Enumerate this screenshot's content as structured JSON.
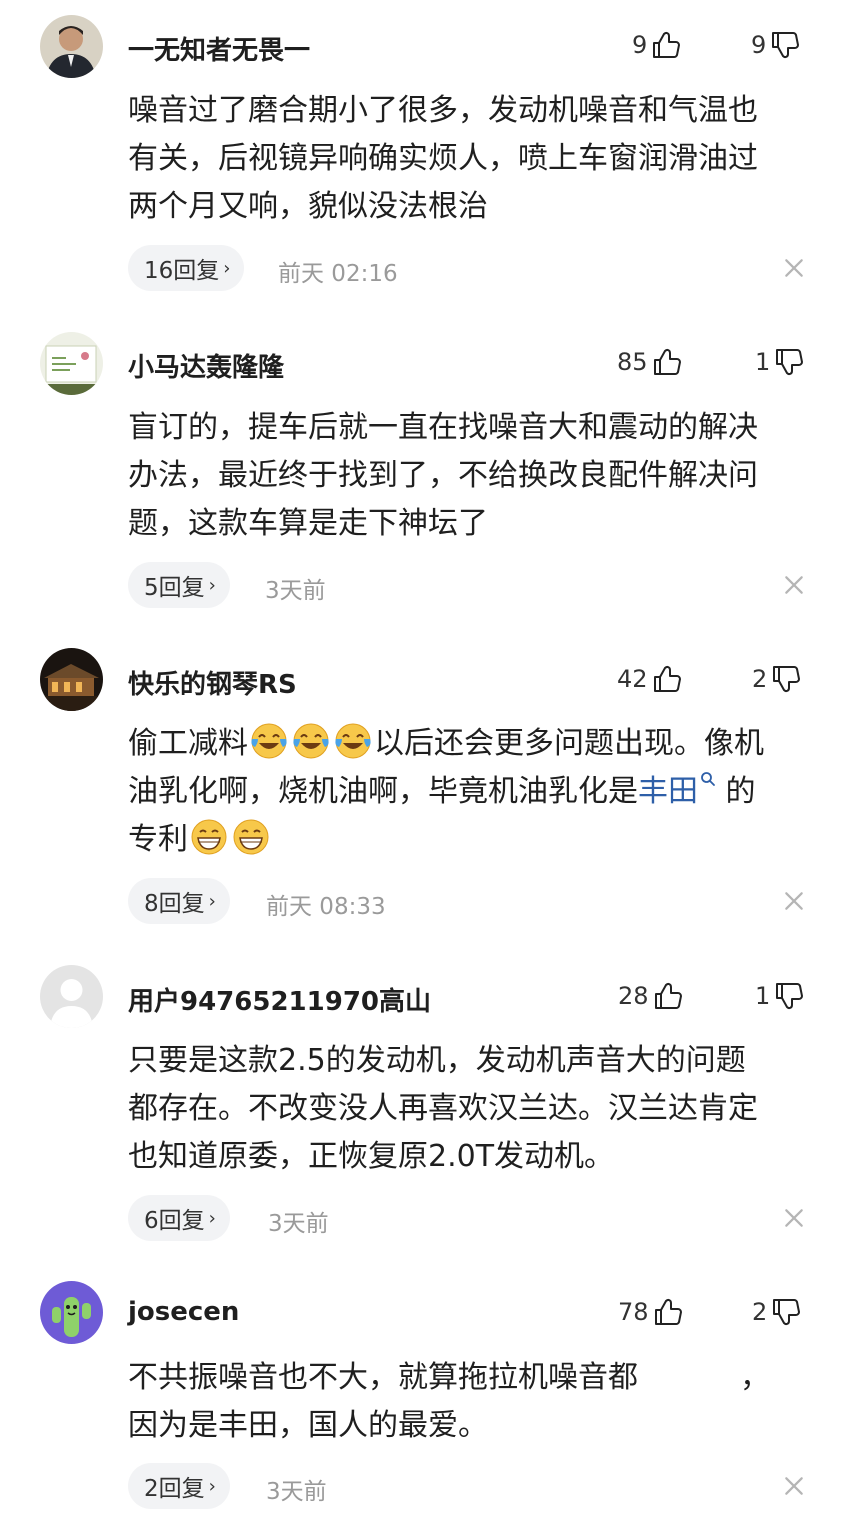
{
  "comments": [
    {
      "username": "一无知者无畏一",
      "likes": "9",
      "dislikes": "9",
      "text_lines": [
        "噪音过了磨合期小了很多，发动机噪音和气温也",
        "有关，后视镜异响确实烦人，喷上车窗润滑油过",
        "两个月又响，貌似没法根治"
      ],
      "reply_label": "16回复",
      "time": "前天 02:16"
    },
    {
      "username": "小马达轰隆隆",
      "likes": "85",
      "dislikes": "1",
      "text_lines": [
        "盲订的，提车后就一直在找噪音大和震动的解决",
        "办法，最近终于找到了，不给换改良配件解决问",
        "题，这款车算是走下神坛了"
      ],
      "reply_label": "5回复",
      "time": "3天前"
    },
    {
      "username": "快乐的钢琴RS",
      "likes": "42",
      "dislikes": "2",
      "text_parts": {
        "line1_a": "偷工减料",
        "line1_b": "以后还会更多问题出现。像机",
        "line2_a": "油乳化啊，烧机油啊，毕竟机油乳化是",
        "link": "丰田",
        "line2_b": "的",
        "line3": "专利"
      },
      "reply_label": "8回复",
      "time": "前天 08:33"
    },
    {
      "username": "用户94765211970高山",
      "likes": "28",
      "dislikes": "1",
      "text_lines": [
        "只要是这款2.5的发动机，发动机声音大的问题",
        "都存在。不改变没人再喜欢汉兰达。汉兰达肯定",
        "也知道原委，正恢复原2.0T发动机。"
      ],
      "reply_label": "6回复",
      "time": "3天前"
    },
    {
      "username": "josecen",
      "likes": "78",
      "dislikes": "2",
      "text_parts": {
        "line1_a": "不共振噪音也不大，就算拖拉机噪音都",
        "line1_blur": "",
        "line1_b": "，",
        "line2": "因为是丰田，国人的最爱。"
      },
      "reply_label": "2回复",
      "time": "3天前"
    }
  ],
  "icons": {
    "like": "thumb-up-icon",
    "dislike": "thumb-down-icon",
    "close": "close-icon",
    "chevron": "chevron-right-icon",
    "laugh_cry": "laugh-cry-emoji",
    "grin": "grin-emoji",
    "search": "search-icon"
  },
  "colors": {
    "link": "#2e5fa8",
    "muted": "#9a9a9a",
    "pill_bg": "#f2f3f5"
  }
}
